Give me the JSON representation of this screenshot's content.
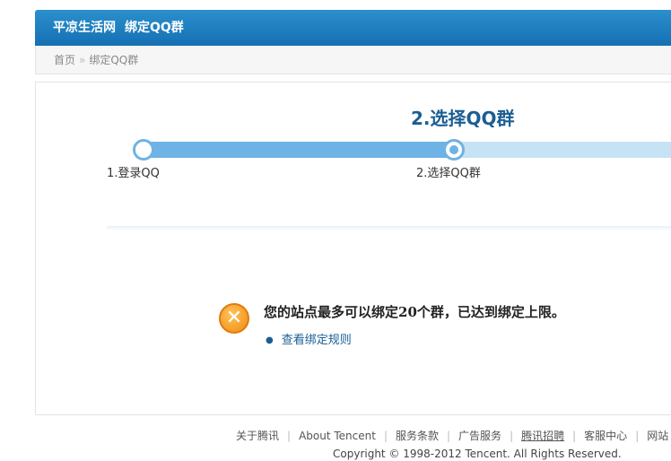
{
  "header": {
    "site": "平凉生活网",
    "title": "绑定QQ群"
  },
  "breadcrumb": {
    "home": "首页",
    "separator": "»",
    "current": "绑定QQ群"
  },
  "steps": {
    "current_title": "2.选择QQ群",
    "items": [
      {
        "label": "1.登录QQ"
      },
      {
        "label": "2.选择QQ群"
      }
    ]
  },
  "message": {
    "icon": "error-x-icon",
    "text": "您的站点最多可以绑定20个群，已达到绑定上限。",
    "link": "查看绑定规则"
  },
  "footer": {
    "links": [
      "关于腾讯",
      "About Tencent",
      "服务条款",
      "广告服务",
      "腾讯招聘",
      "客服中心",
      "网站"
    ],
    "copyright": "Copyright © 1998-2012 Tencent. All Rights Reserved."
  },
  "colors": {
    "header": "#1a7cc0",
    "progress_done": "#6fb2e6",
    "progress_todo": "#c6e3f5",
    "error": "#f08a12"
  }
}
